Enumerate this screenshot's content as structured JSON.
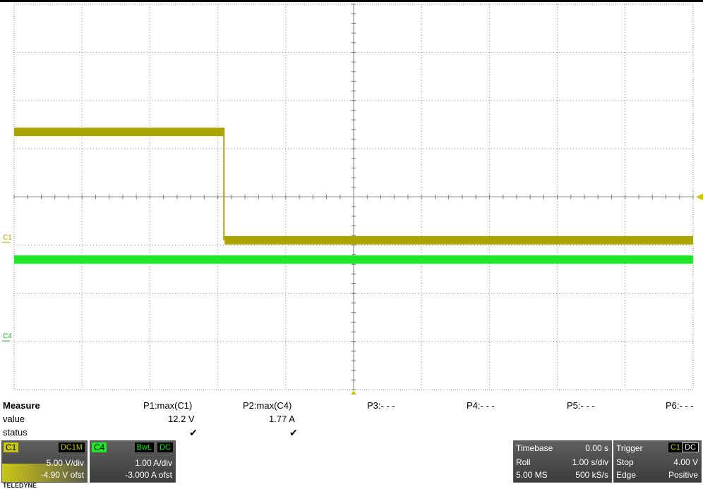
{
  "colors": {
    "c1_trace": "#aaa500",
    "c4_trace": "#22e62a",
    "grid": "#8c8c8c",
    "c1_tag_bg": "#c8c814",
    "c4_tag_bg": "#22e62a"
  },
  "markers": {
    "c1_label": "C1",
    "c4_label": "C4",
    "trigger_level_marker": "left-pointing-triangle",
    "trigger_position_marker": "up-pointing-triangle"
  },
  "waveform": {
    "c1": {
      "high_level_div": 1.35,
      "low_level_div": -0.9,
      "step_at_div": -1.9,
      "level_after_div": -0.9
    },
    "c4": {
      "level_div": -1.3
    }
  },
  "measure": {
    "header": "Measure",
    "row_value": "value",
    "row_status": "status",
    "params": [
      {
        "name": "P1:max(C1)",
        "value": "12.2 V",
        "status": "✔"
      },
      {
        "name": "P2:max(C4)",
        "value": "1.77 A",
        "status": "✔"
      },
      {
        "name": "P3:- - -",
        "value": "",
        "status": ""
      },
      {
        "name": "P4:- - -",
        "value": "",
        "status": ""
      },
      {
        "name": "P5:- - -",
        "value": "",
        "status": ""
      },
      {
        "name": "P6:- - -",
        "value": "",
        "status": ""
      }
    ]
  },
  "c1": {
    "tag": "C1",
    "coupling": "DC1M",
    "vdiv": "5.00 V/div",
    "offset": "-4.90 V ofst"
  },
  "c4": {
    "tag": "C4",
    "bw": "BwL",
    "coupling": "DC",
    "adiv": "1.00 A/div",
    "offset": "-3.000 A ofst"
  },
  "timebase": {
    "label": "Timebase",
    "delay": "0.00 s",
    "mode": "Roll",
    "tdiv": "1.00 s/div",
    "samples": "5.00 MS",
    "rate": "500 kS/s"
  },
  "trigger": {
    "label": "Trigger",
    "source": "C1",
    "coupling": "DC",
    "mode": "Stop",
    "level": "4.00 V",
    "type": "Edge",
    "slope": "Positive"
  },
  "brand": "TELEDYNE"
}
